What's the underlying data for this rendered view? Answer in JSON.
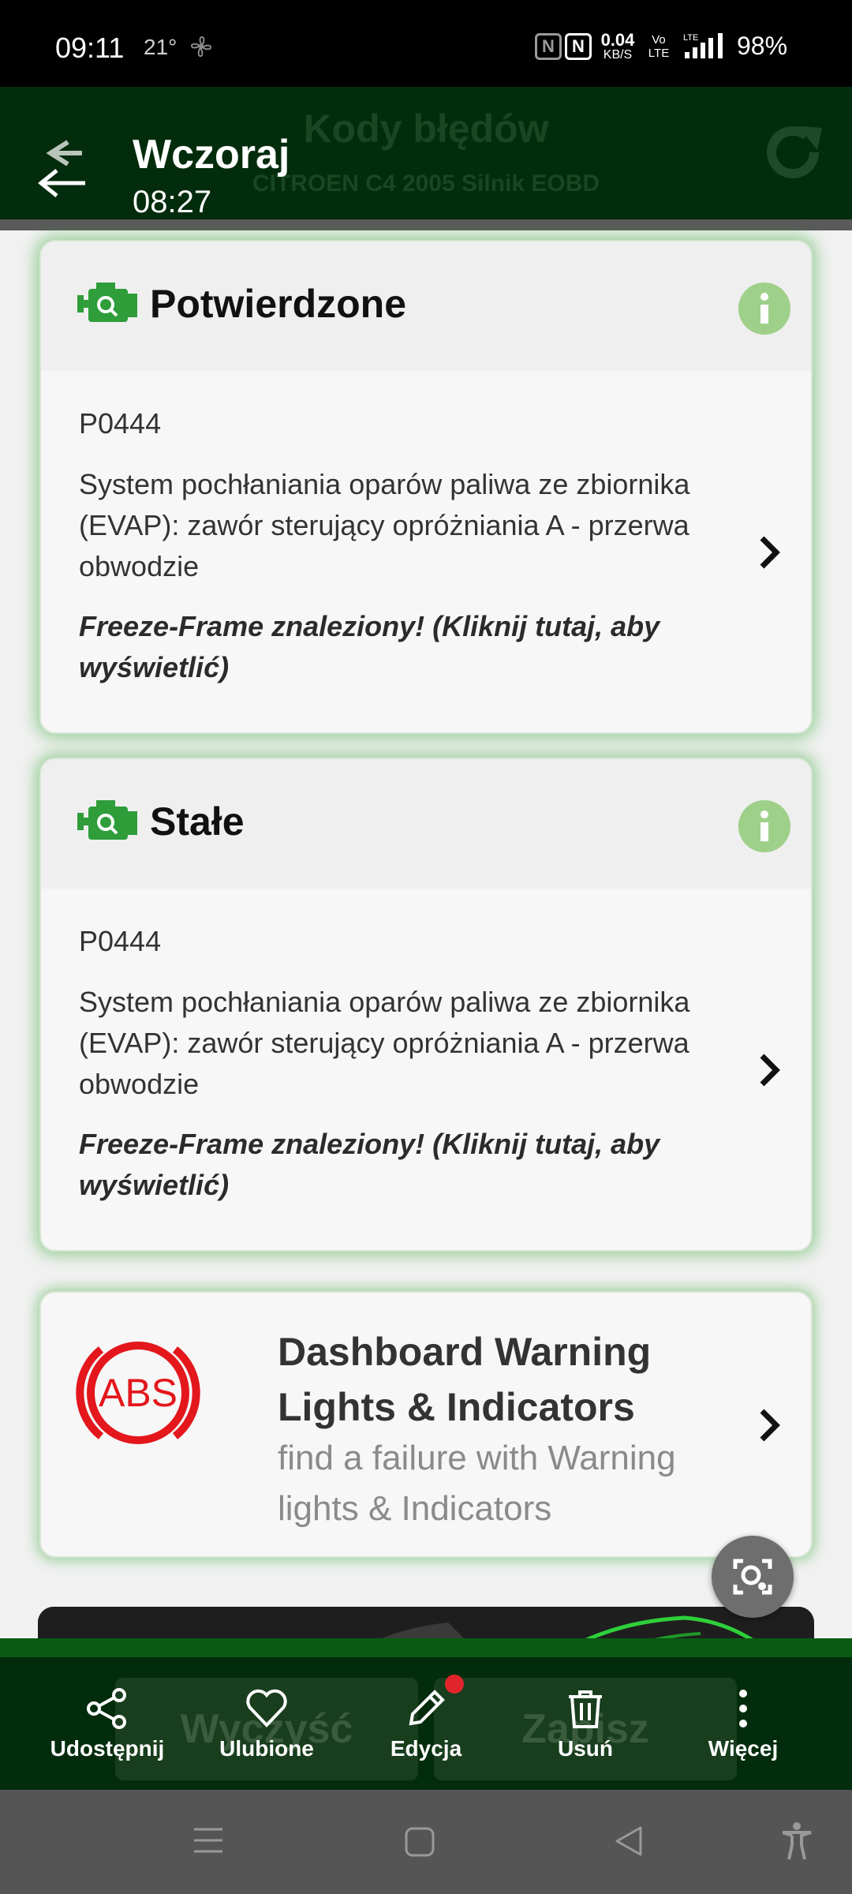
{
  "status_bar": {
    "time": "09:11",
    "temperature": "21°",
    "net_speed_value": "0.04",
    "net_speed_unit": "KB/S",
    "volte_top": "Vo",
    "volte_bottom": "LTE",
    "signal_label": "LTE",
    "battery": "98%"
  },
  "app_bar": {
    "title": "Kody błędów",
    "subtitle": "CITROEN C4 2005 Silnik EOBD",
    "when_label": "Wczoraj",
    "when_time": "08:27"
  },
  "cards": [
    {
      "title": "Potwierdzone",
      "code": "P0444",
      "description": "System pochłaniania oparów paliwa ze zbiornika (EVAP): zawór sterujący opróżniania A - przerwa obwodzie",
      "freeze_frame": "Freeze-Frame znaleziony! (Kliknij tutaj, aby wyświetlić)"
    },
    {
      "title": "Stałe",
      "code": "P0444",
      "description": "System pochłaniania oparów paliwa ze zbiornika (EVAP): zawór sterujący opróżniania A - przerwa obwodzie",
      "freeze_frame": "Freeze-Frame znaleziony! (Kliknij tutaj, aby wyświetlić)"
    }
  ],
  "warning_card": {
    "icon_text": "ABS",
    "title": "Dashboard Warning Lights & Indicators",
    "subtitle": "find a failure with Warning lights & Indicators"
  },
  "ghost_buttons": {
    "clear": "Wyczyść",
    "save": "Zapisz"
  },
  "bottom_nav": [
    {
      "label": "Udostępnij",
      "icon": "share-icon"
    },
    {
      "label": "Ulubione",
      "icon": "heart-icon"
    },
    {
      "label": "Edycja",
      "icon": "pencil-icon"
    },
    {
      "label": "Usuń",
      "icon": "trash-icon"
    },
    {
      "label": "Więcej",
      "icon": "more-vertical-icon"
    }
  ],
  "colors": {
    "app_bar": "#032c0d",
    "accent_green": "#2e9d3a",
    "info": "#9fd08a",
    "abs_red": "#e3171c"
  }
}
